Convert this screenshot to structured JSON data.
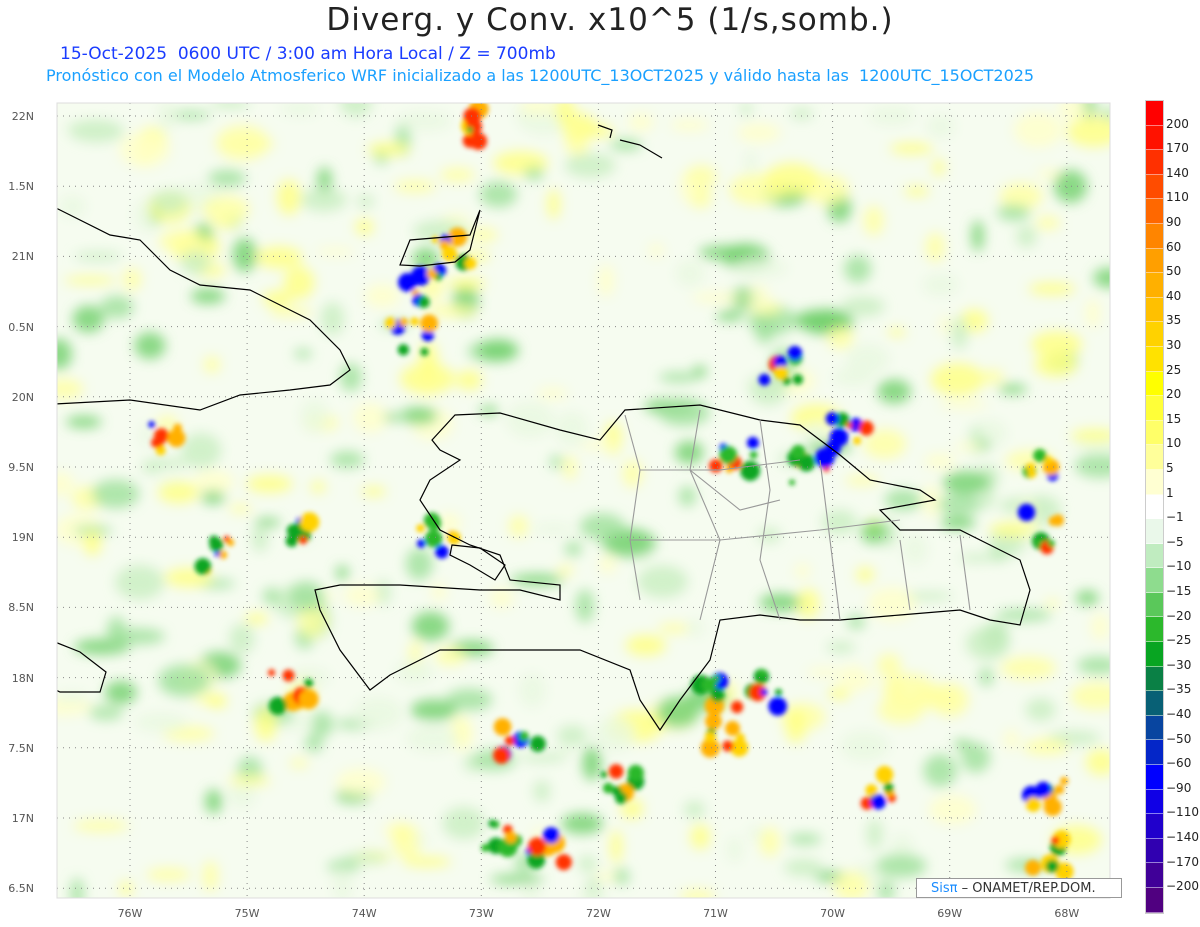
{
  "header": {
    "title": "Diverg. y Conv. x10^5 (1/s,somb.)",
    "subtitle1": "15-Oct-2025  0600 UTC / 3:00 am Hora Local / Z = 700mb",
    "subtitle2": "Pronóstico con el Modelo Atmosferico WRF inicializado a las 1200UTC_13OCT2025 y válido hasta las  1200UTC_15OCT2025"
  },
  "axes": {
    "lat_labels": [
      "22N",
      "1.5N",
      "21N",
      "0.5N",
      "20N",
      "9.5N",
      "19N",
      "8.5N",
      "18N",
      "7.5N",
      "17N",
      "6.5N"
    ],
    "lon_labels": [
      "76W",
      "75W",
      "74W",
      "73W",
      "72W",
      "71W",
      "70W",
      "69W",
      "68W"
    ]
  },
  "colorbar": {
    "labels": [
      "200",
      "170",
      "140",
      "110",
      "90",
      "60",
      "50",
      "40",
      "35",
      "30",
      "25",
      "20",
      "15",
      "10",
      "5",
      "1",
      "−1",
      "−5",
      "−10",
      "−15",
      "−20",
      "−25",
      "−30",
      "−35",
      "−40",
      "−50",
      "−60",
      "−90",
      "−110",
      "−140",
      "−170",
      "−200"
    ],
    "colors": [
      "#ff0000",
      "#ff1200",
      "#ff3000",
      "#ff4c00",
      "#ff6800",
      "#ff8500",
      "#ff9f00",
      "#ffb000",
      "#ffc000",
      "#ffd200",
      "#ffe200",
      "#ffff00",
      "#ffff38",
      "#ffff68",
      "#ffff9a",
      "#ffffd2",
      "#ffffff",
      "#eaf8ea",
      "#c0ecc0",
      "#8edc8e",
      "#5ac85a",
      "#2cb82c",
      "#08a522",
      "#0a8045",
      "#086075",
      "#0845a0",
      "#0426c8",
      "#0000ff",
      "#1000e6",
      "#2000cc",
      "#3000b0",
      "#400098",
      "#500080"
    ]
  },
  "credit": {
    "logo": "Sisπ",
    "text": "– ONAMET/REP.DOM."
  }
}
